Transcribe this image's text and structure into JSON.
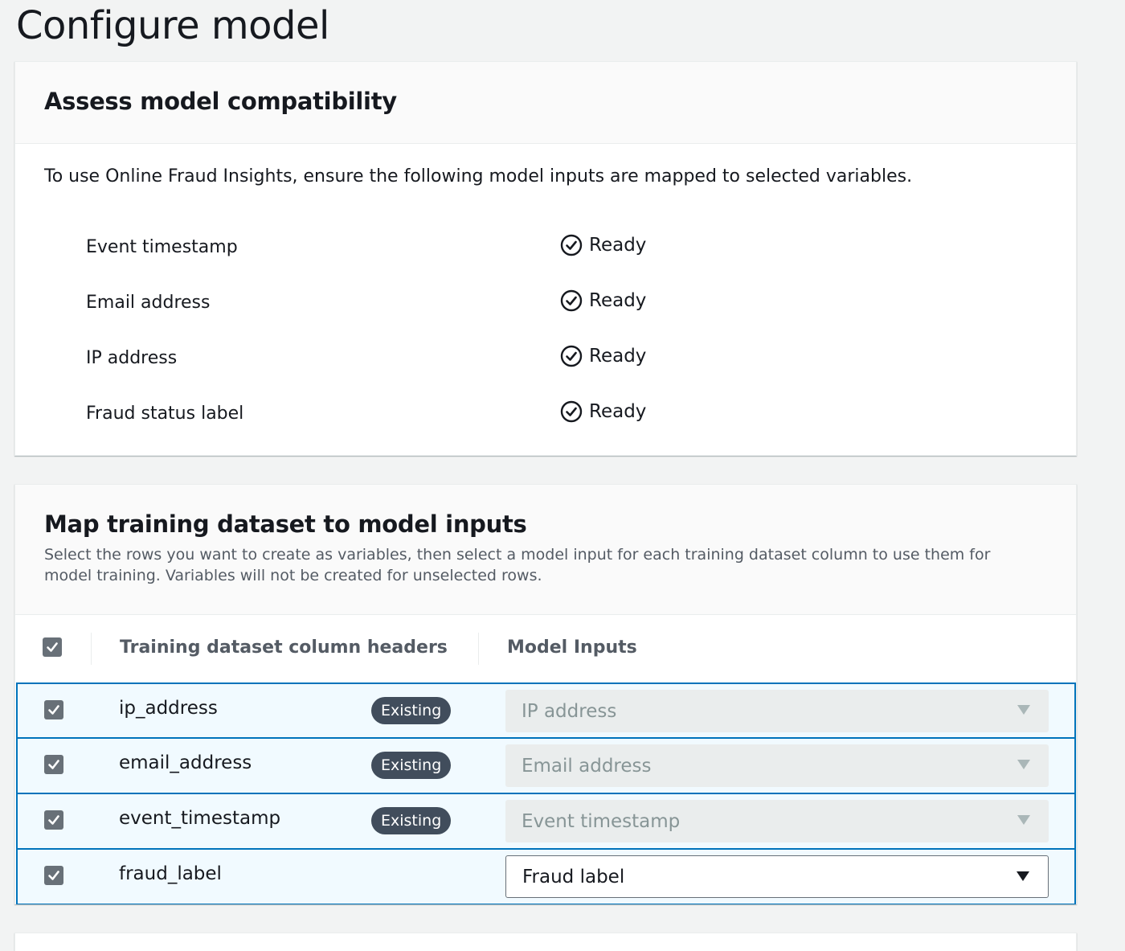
{
  "page": {
    "title": "Configure model"
  },
  "compatibility": {
    "title": "Assess model compatibility",
    "intro": "To use Online Fraud Insights, ensure the following model inputs are mapped to selected variables.",
    "requirements": [
      {
        "name": "Event timestamp",
        "status": "Ready",
        "icon": "check-circle-icon"
      },
      {
        "name": "Email address",
        "status": "Ready",
        "icon": "check-circle-icon"
      },
      {
        "name": "IP address",
        "status": "Ready",
        "icon": "check-circle-icon"
      },
      {
        "name": "Fraud status label",
        "status": "Ready",
        "icon": "check-circle-icon"
      }
    ]
  },
  "mapping": {
    "title": "Map training dataset to model inputs",
    "description": "Select the rows you want to create as variables, then select a model input for each training dataset column to use them for model training. Variables will not be created for unselected rows.",
    "headers": {
      "select_all_checked": true,
      "column": "Training dataset column headers",
      "inputs": "Model Inputs"
    },
    "rows": [
      {
        "checked": true,
        "column": "ip_address",
        "badge": "Existing",
        "input": "IP address",
        "disabled": true
      },
      {
        "checked": true,
        "column": "email_address",
        "badge": "Existing",
        "input": "Email address",
        "disabled": true
      },
      {
        "checked": true,
        "column": "event_timestamp",
        "badge": "Existing",
        "input": "Event timestamp",
        "disabled": true
      },
      {
        "checked": true,
        "column": "fraud_label",
        "badge": "",
        "input": "Fraud label",
        "disabled": false
      }
    ]
  },
  "colors": {
    "selected_row_bg": "#f1faff",
    "selected_row_border": "#0073bb",
    "badge_bg": "#414d5c",
    "checkbox_bg": "#687078"
  }
}
